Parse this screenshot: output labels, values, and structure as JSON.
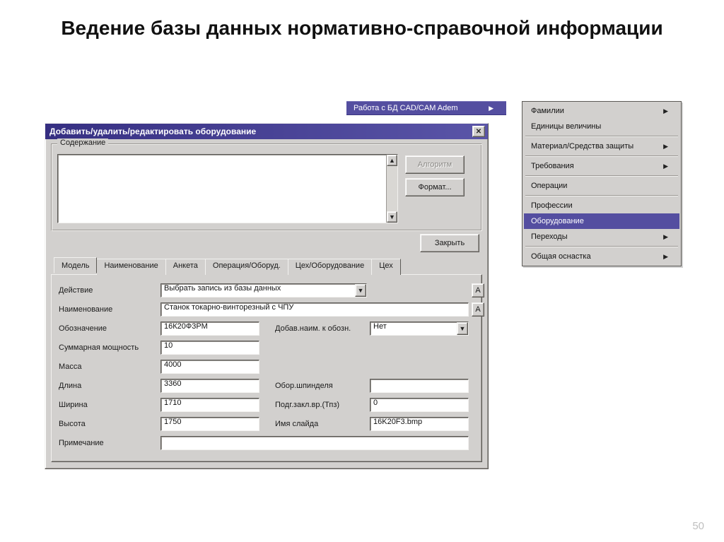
{
  "slide_title": "Ведение базы данных нормативно-справочной информации",
  "page_number": "50",
  "menu_root": {
    "label": "Работа с БД CAD/CAM Adem"
  },
  "submenu": [
    {
      "label": "Фамилии",
      "arrow": "▶"
    },
    {
      "label": "Единицы величины",
      "arrow": ""
    },
    {
      "sep": true
    },
    {
      "label": "Материал/Средства защиты",
      "arrow": "▶"
    },
    {
      "sep": true
    },
    {
      "label": "Требования",
      "arrow": "▶"
    },
    {
      "sep": true
    },
    {
      "label": "Операции",
      "arrow": ""
    },
    {
      "sep": true
    },
    {
      "label": "Профессии",
      "arrow": ""
    },
    {
      "label": "Оборудование",
      "arrow": "",
      "selected": true
    },
    {
      "label": "Переходы",
      "arrow": "▶"
    },
    {
      "sep": true
    },
    {
      "label": "Общая оснастка",
      "arrow": "▶"
    }
  ],
  "dialog": {
    "title": "Добавить/удалить/редактировать оборудование",
    "close_x": "✕",
    "group_content": "Содержание",
    "btn_algorithm": "Алгоритм",
    "btn_format": "Формат...",
    "btn_close": "Закрыть",
    "tabs": [
      "Модель",
      "Наименование",
      "Анкета",
      "Операция/Оборуд.",
      "Цех/Оборудование",
      "Цех"
    ],
    "form": {
      "action_label": "Действие",
      "action_value": "Выбрать запись из базы данных",
      "name_label": "Наименование",
      "name_value": "Станок токарно-винторезный с ЧПУ",
      "desig_label": "Обозначение",
      "desig_value": "16К20Ф3РМ",
      "addname_label": "Добав.наим. к обозн.",
      "addname_value": "Нет",
      "power_label": "Суммарная мощность",
      "power_value": "10",
      "mass_label": "Масса",
      "mass_value": "4000",
      "length_label": "Длина",
      "length_value": "3360",
      "spindle_label": "Обор.шпинделя",
      "spindle_value": "",
      "width_label": "Ширина",
      "width_value": "1710",
      "tpz_label": "Подг.закл.вр.(Тпз)",
      "tpz_value": "0",
      "height_label": "Высота",
      "height_value": "1750",
      "slide_label": "Имя слайда",
      "slide_value": "16K20F3.bmp",
      "note_label": "Примечание",
      "note_value": "",
      "a_btn": "А"
    }
  }
}
